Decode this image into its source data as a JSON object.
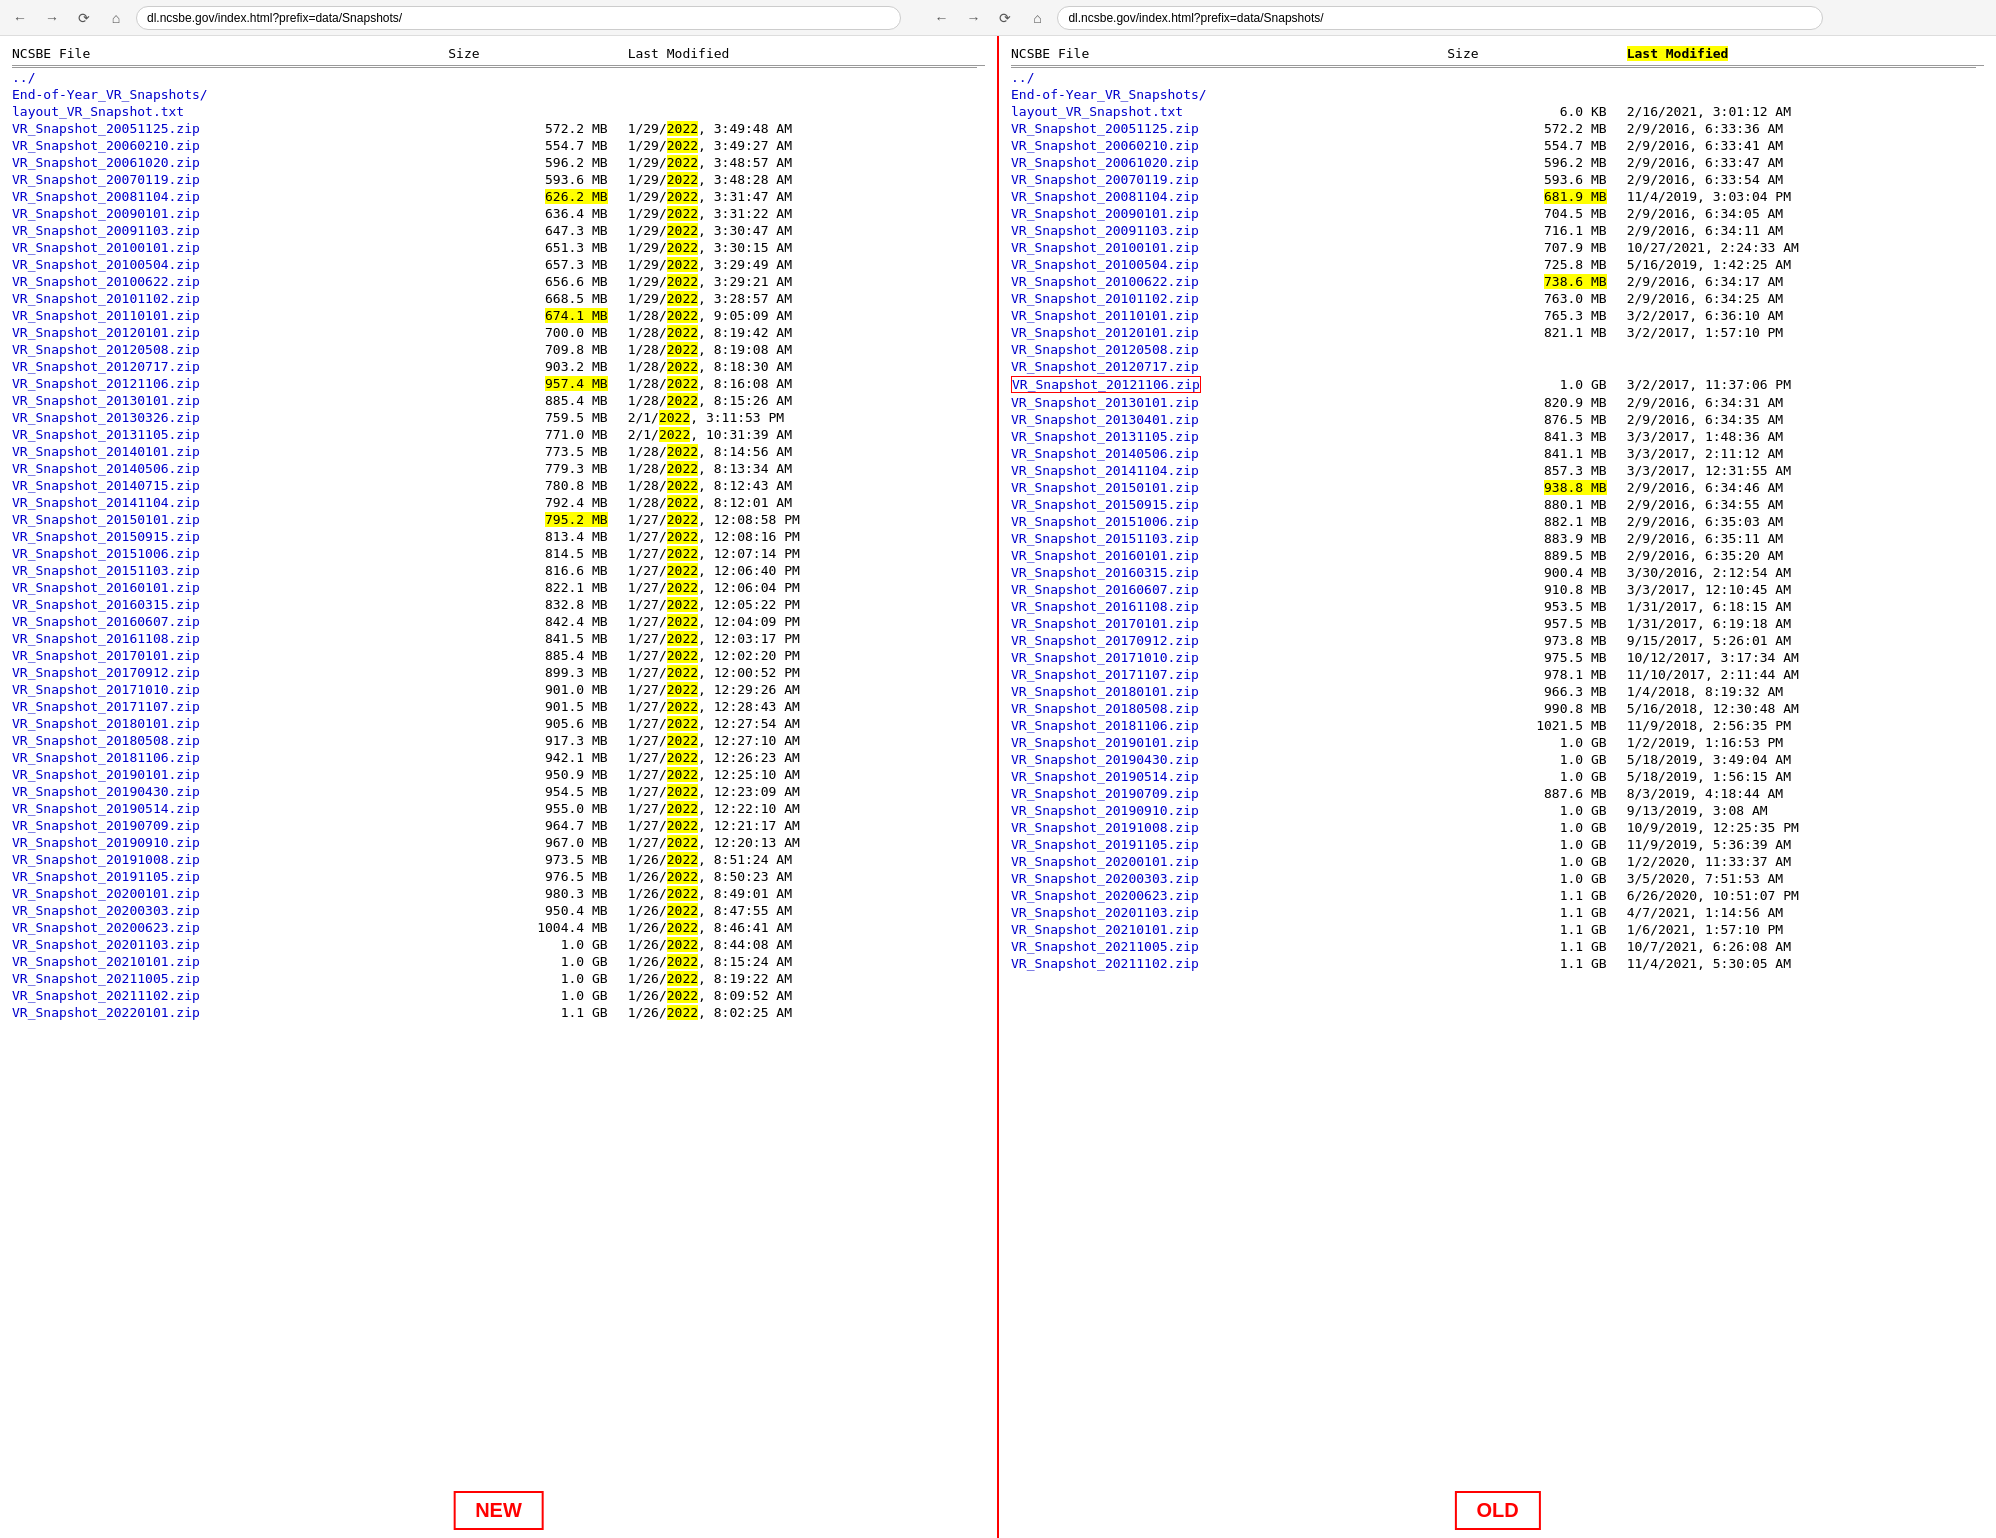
{
  "url": "dl.ncsbe.gov/index.html?prefix=data/Snapshots/",
  "columns": {
    "name": "NCSBE File",
    "size": "Size",
    "modified": "Last Modified"
  },
  "left_pane": {
    "label": "NEW",
    "parent_link": "../",
    "folder_link": "End-of-Year_VR_Snapshots/",
    "files": [
      {
        "name": "layout_VR_Snapshot.txt",
        "size": "",
        "modified": ""
      },
      {
        "name": "VR_Snapshot_20051125.zip",
        "size": "572.2 MB",
        "modified": "1/29/2022, 3:49:48 AM",
        "highlight_year": true
      },
      {
        "name": "VR_Snapshot_20060210.zip",
        "size": "554.7 MB",
        "modified": "1/29/2022, 3:49:27 AM",
        "highlight_year": true
      },
      {
        "name": "VR_Snapshot_20061020.zip",
        "size": "596.2 MB",
        "modified": "1/29/2022, 3:48:57 AM",
        "highlight_year": true
      },
      {
        "name": "VR_Snapshot_20070119.zip",
        "size": "593.6 MB",
        "modified": "1/29/2022, 3:48:28 AM",
        "highlight_year": true
      },
      {
        "name": "VR_Snapshot_20081104.zip",
        "size": "626.2 MB",
        "modified": "1/29/2022, 3:31:47 AM",
        "highlight_year": true,
        "highlight_size": true
      },
      {
        "name": "VR_Snapshot_20090101.zip",
        "size": "636.4 MB",
        "modified": "1/29/2022, 3:31:22 AM",
        "highlight_year": true
      },
      {
        "name": "VR_Snapshot_20091103.zip",
        "size": "647.3 MB",
        "modified": "1/29/2022, 3:30:47 AM",
        "highlight_year": true
      },
      {
        "name": "VR_Snapshot_20100101.zip",
        "size": "651.3 MB",
        "modified": "1/29/2022, 3:30:15 AM",
        "highlight_year": true
      },
      {
        "name": "VR_Snapshot_20100504.zip",
        "size": "657.3 MB",
        "modified": "1/29/2022, 3:29:49 AM",
        "highlight_year": true
      },
      {
        "name": "VR_Snapshot_20100622.zip",
        "size": "656.6 MB",
        "modified": "1/29/2022, 3:29:21 AM",
        "highlight_year": true
      },
      {
        "name": "VR_Snapshot_20101102.zip",
        "size": "668.5 MB",
        "modified": "1/29/2022, 3:28:57 AM",
        "highlight_year": true
      },
      {
        "name": "VR_Snapshot_20110101.zip",
        "size": "674.1 MB",
        "modified": "1/28/2022, 9:05:09 AM",
        "highlight_year": true,
        "highlight_size": true
      },
      {
        "name": "VR_Snapshot_20120101.zip",
        "size": "700.0 MB",
        "modified": "1/28/2022, 8:19:42 AM",
        "highlight_year": true
      },
      {
        "name": "VR_Snapshot_20120508.zip",
        "size": "709.8 MB",
        "modified": "1/28/2022, 8:19:08 AM",
        "highlight_year": true
      },
      {
        "name": "VR_Snapshot_20120717.zip",
        "size": "903.2 MB",
        "modified": "1/28/2022, 8:18:30 AM",
        "highlight_year": true
      },
      {
        "name": "VR_Snapshot_20121106.zip",
        "size": "957.4 MB",
        "modified": "1/28/2022, 8:16:08 AM",
        "highlight_year": true,
        "highlight_size": true
      },
      {
        "name": "VR_Snapshot_20130101.zip",
        "size": "885.4 MB",
        "modified": "1/28/2022, 8:15:26 AM",
        "highlight_year": true
      },
      {
        "name": "VR_Snapshot_20130326.zip",
        "size": "759.5 MB",
        "modified": "2/1/2022, 3:11:53 PM",
        "highlight_year": true
      },
      {
        "name": "VR_Snapshot_20131105.zip",
        "size": "771.0 MB",
        "modified": "2/1/2022, 10:31:39 AM",
        "highlight_year": true
      },
      {
        "name": "VR_Snapshot_20140101.zip",
        "size": "773.5 MB",
        "modified": "1/28/2022, 8:14:56 AM",
        "highlight_year": true
      },
      {
        "name": "VR_Snapshot_20140506.zip",
        "size": "779.3 MB",
        "modified": "1/28/2022, 8:13:34 AM",
        "highlight_year": true
      },
      {
        "name": "VR_Snapshot_20140715.zip",
        "size": "780.8 MB",
        "modified": "1/28/2022, 8:12:43 AM",
        "highlight_year": true
      },
      {
        "name": "VR_Snapshot_20141104.zip",
        "size": "792.4 MB",
        "modified": "1/28/2022, 8:12:01 AM",
        "highlight_year": true
      },
      {
        "name": "VR_Snapshot_20150101.zip",
        "size": "795.2 MB",
        "modified": "1/27/2022, 12:08:58 PM",
        "highlight_year": true,
        "highlight_size": true
      },
      {
        "name": "VR_Snapshot_20150915.zip",
        "size": "813.4 MB",
        "modified": "1/27/2022, 12:08:16 PM",
        "highlight_year": true
      },
      {
        "name": "VR_Snapshot_20151006.zip",
        "size": "814.5 MB",
        "modified": "1/27/2022, 12:07:14 PM",
        "highlight_year": true
      },
      {
        "name": "VR_Snapshot_20151103.zip",
        "size": "816.6 MB",
        "modified": "1/27/2022, 12:06:40 PM",
        "highlight_year": true
      },
      {
        "name": "VR_Snapshot_20160101.zip",
        "size": "822.1 MB",
        "modified": "1/27/2022, 12:06:04 PM",
        "highlight_year": true
      },
      {
        "name": "VR_Snapshot_20160315.zip",
        "size": "832.8 MB",
        "modified": "1/27/2022, 12:05:22 PM",
        "highlight_year": true
      },
      {
        "name": "VR_Snapshot_20160607.zip",
        "size": "842.4 MB",
        "modified": "1/27/2022, 12:04:09 PM",
        "highlight_year": true
      },
      {
        "name": "VR_Snapshot_20161108.zip",
        "size": "841.5 MB",
        "modified": "1/27/2022, 12:03:17 PM",
        "highlight_year": true
      },
      {
        "name": "VR_Snapshot_20170101.zip",
        "size": "885.4 MB",
        "modified": "1/27/2022, 12:02:20 PM",
        "highlight_year": true
      },
      {
        "name": "VR_Snapshot_20170912.zip",
        "size": "899.3 MB",
        "modified": "1/27/2022, 12:00:52 PM",
        "highlight_year": true
      },
      {
        "name": "VR_Snapshot_20171010.zip",
        "size": "901.0 MB",
        "modified": "1/27/2022, 12:29:26 AM",
        "highlight_year": true
      },
      {
        "name": "VR_Snapshot_20171107.zip",
        "size": "901.5 MB",
        "modified": "1/27/2022, 12:28:43 AM",
        "highlight_year": true
      },
      {
        "name": "VR_Snapshot_20180101.zip",
        "size": "905.6 MB",
        "modified": "1/27/2022, 12:27:54 AM",
        "highlight_year": true
      },
      {
        "name": "VR_Snapshot_20180508.zip",
        "size": "917.3 MB",
        "modified": "1/27/2022, 12:27:10 AM",
        "highlight_year": true
      },
      {
        "name": "VR_Snapshot_20181106.zip",
        "size": "942.1 MB",
        "modified": "1/27/2022, 12:26:23 AM",
        "highlight_year": true
      },
      {
        "name": "VR_Snapshot_20190101.zip",
        "size": "950.9 MB",
        "modified": "1/27/2022, 12:25:10 AM",
        "highlight_year": true
      },
      {
        "name": "VR_Snapshot_20190430.zip",
        "size": "954.5 MB",
        "modified": "1/27/2022, 12:23:09 AM",
        "highlight_year": true
      },
      {
        "name": "VR_Snapshot_20190514.zip",
        "size": "955.0 MB",
        "modified": "1/27/2022, 12:22:10 AM",
        "highlight_year": true
      },
      {
        "name": "VR_Snapshot_20190709.zip",
        "size": "964.7 MB",
        "modified": "1/27/2022, 12:21:17 AM",
        "highlight_year": true
      },
      {
        "name": "VR_Snapshot_20190910.zip",
        "size": "967.0 MB",
        "modified": "1/27/2022, 12:20:13 AM",
        "highlight_year": true
      },
      {
        "name": "VR_Snapshot_20191008.zip",
        "size": "973.5 MB",
        "modified": "1/26/2022, 8:51:24 AM",
        "highlight_year": true
      },
      {
        "name": "VR_Snapshot_20191105.zip",
        "size": "976.5 MB",
        "modified": "1/26/2022, 8:50:23 AM",
        "highlight_year": true
      },
      {
        "name": "VR_Snapshot_20200101.zip",
        "size": "980.3 MB",
        "modified": "1/26/2022, 8:49:01 AM",
        "highlight_year": true
      },
      {
        "name": "VR_Snapshot_20200303.zip",
        "size": "950.4 MB",
        "modified": "1/26/2022, 8:47:55 AM",
        "highlight_year": true
      },
      {
        "name": "VR_Snapshot_20200623.zip",
        "size": "1004.4 MB",
        "modified": "1/26/2022, 8:46:41 AM",
        "highlight_year": true
      },
      {
        "name": "VR_Snapshot_20201103.zip",
        "size": "1.0 GB",
        "modified": "1/26/2022, 8:44:08 AM",
        "highlight_year": true
      },
      {
        "name": "VR_Snapshot_20210101.zip",
        "size": "1.0 GB",
        "modified": "1/26/2022, 8:15:24 AM",
        "highlight_year": true
      },
      {
        "name": "VR_Snapshot_20211005.zip",
        "size": "1.0 GB",
        "modified": "1/26/2022, 8:19:22 AM",
        "highlight_year": true
      },
      {
        "name": "VR_Snapshot_20211102.zip",
        "size": "1.0 GB",
        "modified": "1/26/2022, 8:09:52 AM",
        "highlight_year": true
      },
      {
        "name": "VR_Snapshot_20220101.zip",
        "size": "1.1 GB",
        "modified": "1/26/2022, 8:02:25 AM",
        "highlight_year": true
      }
    ]
  },
  "right_pane": {
    "label": "OLD",
    "parent_link": "../",
    "folder_link": "End-of-Year_VR_Snapshots/",
    "highlight_header": true,
    "files": [
      {
        "name": "layout_VR_Snapshot.txt",
        "size": "6.0 KB",
        "modified": "2/16/2021, 3:01:12 AM"
      },
      {
        "name": "VR_Snapshot_20051125.zip",
        "size": "572.2 MB",
        "modified": "2/9/2016, 6:33:36 AM"
      },
      {
        "name": "VR_Snapshot_20060210.zip",
        "size": "554.7 MB",
        "modified": "2/9/2016, 6:33:41 AM"
      },
      {
        "name": "VR_Snapshot_20061020.zip",
        "size": "596.2 MB",
        "modified": "2/9/2016, 6:33:47 AM"
      },
      {
        "name": "VR_Snapshot_20070119.zip",
        "size": "593.6 MB",
        "modified": "2/9/2016, 6:33:54 AM"
      },
      {
        "name": "VR_Snapshot_20081104.zip",
        "size": "681.9 MB",
        "modified": "11/4/2019, 3:03:04 PM",
        "highlight_size": true
      },
      {
        "name": "VR_Snapshot_20090101.zip",
        "size": "704.5 MB",
        "modified": "2/9/2016, 6:34:05 AM"
      },
      {
        "name": "VR_Snapshot_20091103.zip",
        "size": "716.1 MB",
        "modified": "2/9/2016, 6:34:11 AM"
      },
      {
        "name": "VR_Snapshot_20100101.zip",
        "size": "707.9 MB",
        "modified": "10/27/2021, 2:24:33 AM"
      },
      {
        "name": "VR_Snapshot_20100504.zip",
        "size": "725.8 MB",
        "modified": "5/16/2019, 1:42:25 AM"
      },
      {
        "name": "VR_Snapshot_20100622.zip",
        "size": "738.6 MB",
        "modified": "2/9/2016, 6:34:17 AM",
        "highlight_size": true
      },
      {
        "name": "VR_Snapshot_20101102.zip",
        "size": "763.0 MB",
        "modified": "2/9/2016, 6:34:25 AM"
      },
      {
        "name": "VR_Snapshot_20110101.zip",
        "size": "765.3 MB",
        "modified": "3/2/2017, 6:36:10 AM"
      },
      {
        "name": "VR_Snapshot_20120101.zip",
        "size": "821.1 MB",
        "modified": "3/2/2017, 1:57:10 PM"
      },
      {
        "name": "VR_Snapshot_20120508.zip",
        "size": "",
        "modified": ""
      },
      {
        "name": "VR_Snapshot_20120717.zip",
        "size": "",
        "modified": ""
      },
      {
        "name": "VR_Snapshot_20121106.zip",
        "size": "1.0 GB",
        "modified": "3/2/2017, 11:37:06 PM",
        "highlight_border": true
      },
      {
        "name": "VR_Snapshot_20130101.zip",
        "size": "820.9 MB",
        "modified": "2/9/2016, 6:34:31 AM"
      },
      {
        "name": "VR_Snapshot_20130401.zip",
        "size": "876.5 MB",
        "modified": "2/9/2016, 6:34:35 AM"
      },
      {
        "name": "VR_Snapshot_20131105.zip",
        "size": "841.3 MB",
        "modified": "3/3/2017, 1:48:36 AM"
      },
      {
        "name": "VR_Snapshot_20140506.zip",
        "size": "841.1 MB",
        "modified": "3/3/2017, 2:11:12 AM"
      },
      {
        "name": "VR_Snapshot_20141104.zip",
        "size": "857.3 MB",
        "modified": "3/3/2017, 12:31:55 AM"
      },
      {
        "name": "VR_Snapshot_20150101.zip",
        "size": "938.8 MB",
        "modified": "2/9/2016, 6:34:46 AM",
        "highlight_size": true
      },
      {
        "name": "VR_Snapshot_20150915.zip",
        "size": "880.1 MB",
        "modified": "2/9/2016, 6:34:55 AM"
      },
      {
        "name": "VR_Snapshot_20151006.zip",
        "size": "882.1 MB",
        "modified": "2/9/2016, 6:35:03 AM"
      },
      {
        "name": "VR_Snapshot_20151103.zip",
        "size": "883.9 MB",
        "modified": "2/9/2016, 6:35:11 AM"
      },
      {
        "name": "VR_Snapshot_20160101.zip",
        "size": "889.5 MB",
        "modified": "2/9/2016, 6:35:20 AM"
      },
      {
        "name": "VR_Snapshot_20160315.zip",
        "size": "900.4 MB",
        "modified": "3/30/2016, 2:12:54 AM"
      },
      {
        "name": "VR_Snapshot_20160607.zip",
        "size": "910.8 MB",
        "modified": "3/3/2017, 12:10:45 AM"
      },
      {
        "name": "VR_Snapshot_20161108.zip",
        "size": "953.5 MB",
        "modified": "1/31/2017, 6:18:15 AM"
      },
      {
        "name": "VR_Snapshot_20170101.zip",
        "size": "957.5 MB",
        "modified": "1/31/2017, 6:19:18 AM"
      },
      {
        "name": "VR_Snapshot_20170912.zip",
        "size": "973.8 MB",
        "modified": "9/15/2017, 5:26:01 AM"
      },
      {
        "name": "VR_Snapshot_20171010.zip",
        "size": "975.5 MB",
        "modified": "10/12/2017, 3:17:34 AM"
      },
      {
        "name": "VR_Snapshot_20171107.zip",
        "size": "978.1 MB",
        "modified": "11/10/2017, 2:11:44 AM"
      },
      {
        "name": "VR_Snapshot_20180101.zip",
        "size": "966.3 MB",
        "modified": "1/4/2018, 8:19:32 AM"
      },
      {
        "name": "VR_Snapshot_20180508.zip",
        "size": "990.8 MB",
        "modified": "5/16/2018, 12:30:48 AM"
      },
      {
        "name": "VR_Snapshot_20181106.zip",
        "size": "1021.5 MB",
        "modified": "11/9/2018, 2:56:35 PM"
      },
      {
        "name": "VR_Snapshot_20190101.zip",
        "size": "1.0 GB",
        "modified": "1/2/2019, 1:16:53 PM"
      },
      {
        "name": "VR_Snapshot_20190430.zip",
        "size": "1.0 GB",
        "modified": "5/18/2019, 3:49:04 AM"
      },
      {
        "name": "VR_Snapshot_20190514.zip",
        "size": "1.0 GB",
        "modified": "5/18/2019, 1:56:15 AM"
      },
      {
        "name": "VR_Snapshot_20190709.zip",
        "size": "887.6 MB",
        "modified": "8/3/2019, 4:18:44 AM"
      },
      {
        "name": "VR_Snapshot_20190910.zip",
        "size": "1.0 GB",
        "modified": "9/13/2019, 3:08 AM"
      },
      {
        "name": "VR_Snapshot_20191008.zip",
        "size": "1.0 GB",
        "modified": "10/9/2019, 12:25:35 PM"
      },
      {
        "name": "VR_Snapshot_20191105.zip",
        "size": "1.0 GB",
        "modified": "11/9/2019, 5:36:39 AM"
      },
      {
        "name": "VR_Snapshot_20200101.zip",
        "size": "1.0 GB",
        "modified": "1/2/2020, 11:33:37 AM"
      },
      {
        "name": "VR_Snapshot_20200303.zip",
        "size": "1.0 GB",
        "modified": "3/5/2020, 7:51:53 AM"
      },
      {
        "name": "VR_Snapshot_20200623.zip",
        "size": "1.1 GB",
        "modified": "6/26/2020, 10:51:07 PM"
      },
      {
        "name": "VR_Snapshot_20201103.zip",
        "size": "1.1 GB",
        "modified": "4/7/2021, 1:14:56 AM"
      },
      {
        "name": "VR_Snapshot_20210101.zip",
        "size": "1.1 GB",
        "modified": "1/6/2021, 1:57:10 PM"
      },
      {
        "name": "VR_Snapshot_20211005.zip",
        "size": "1.1 GB",
        "modified": "10/7/2021, 6:26:08 AM"
      },
      {
        "name": "VR_Snapshot_20211102.zip",
        "size": "1.1 GB",
        "modified": "11/4/2021, 5:30:05 AM"
      }
    ]
  }
}
